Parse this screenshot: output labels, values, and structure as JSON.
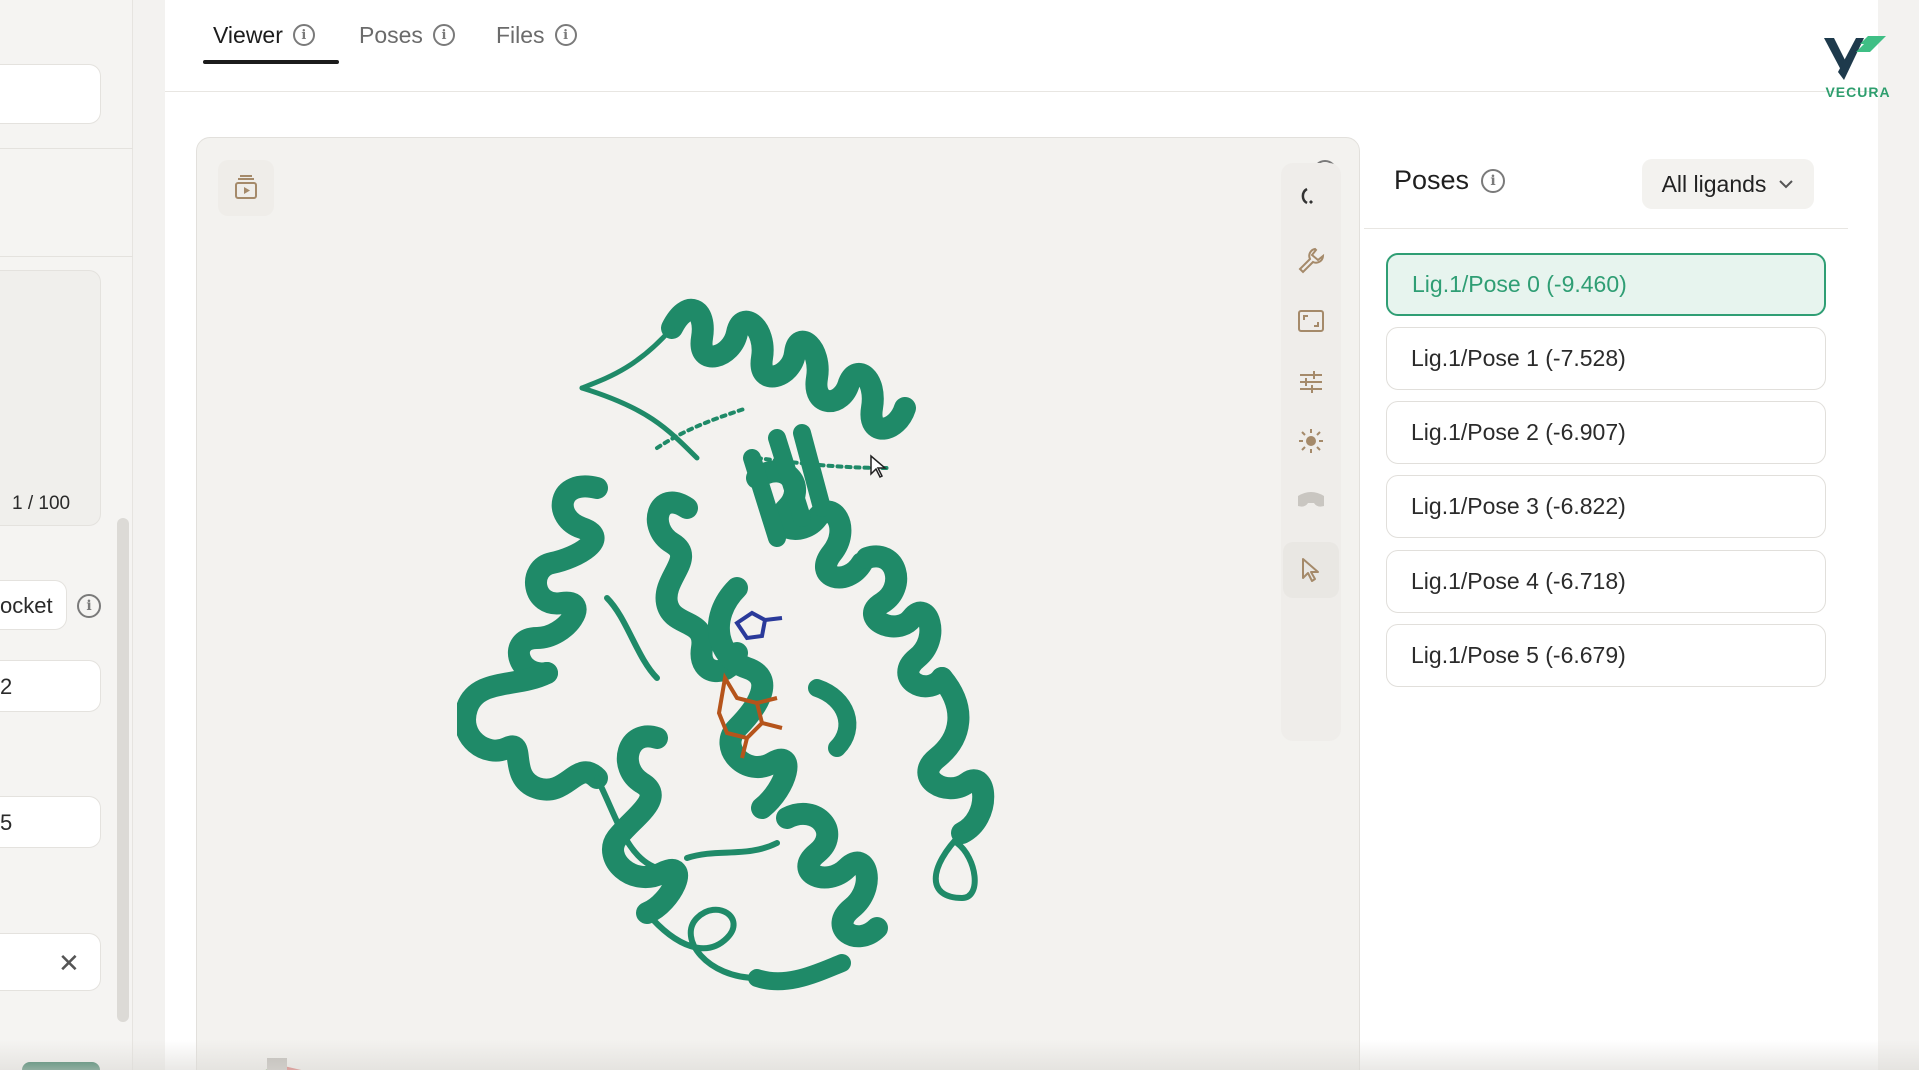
{
  "brand": {
    "name": "VECURA",
    "color": "#2e9e6e"
  },
  "tabs": [
    {
      "label": "Viewer",
      "active": true
    },
    {
      "label": "Poses",
      "active": false
    },
    {
      "label": "Files",
      "active": false
    }
  ],
  "sidebar": {
    "pager": "1 / 100",
    "pocket_label": "ocket",
    "field_1_value": "2",
    "field_2_value": "5"
  },
  "viewer": {
    "toolbar_icons": [
      "reset-view-icon",
      "wrench-icon",
      "fullscreen-icon",
      "sliders-icon",
      "brightness-icon",
      "vr-headset-icon",
      "pointer-icon"
    ],
    "protein_color": "#1f8a68",
    "ligand_color": "#b5541b"
  },
  "poses": {
    "title": "Poses",
    "filter": "All ligands",
    "items": [
      {
        "label": "Lig.1/Pose 0 (-9.460)",
        "selected": true
      },
      {
        "label": "Lig.1/Pose 1 (-7.528)",
        "selected": false
      },
      {
        "label": "Lig.1/Pose 2 (-6.907)",
        "selected": false
      },
      {
        "label": "Lig.1/Pose 3 (-6.822)",
        "selected": false
      },
      {
        "label": "Lig.1/Pose 4 (-6.718)",
        "selected": false
      },
      {
        "label": "Lig.1/Pose 5 (-6.679)",
        "selected": false
      }
    ]
  }
}
